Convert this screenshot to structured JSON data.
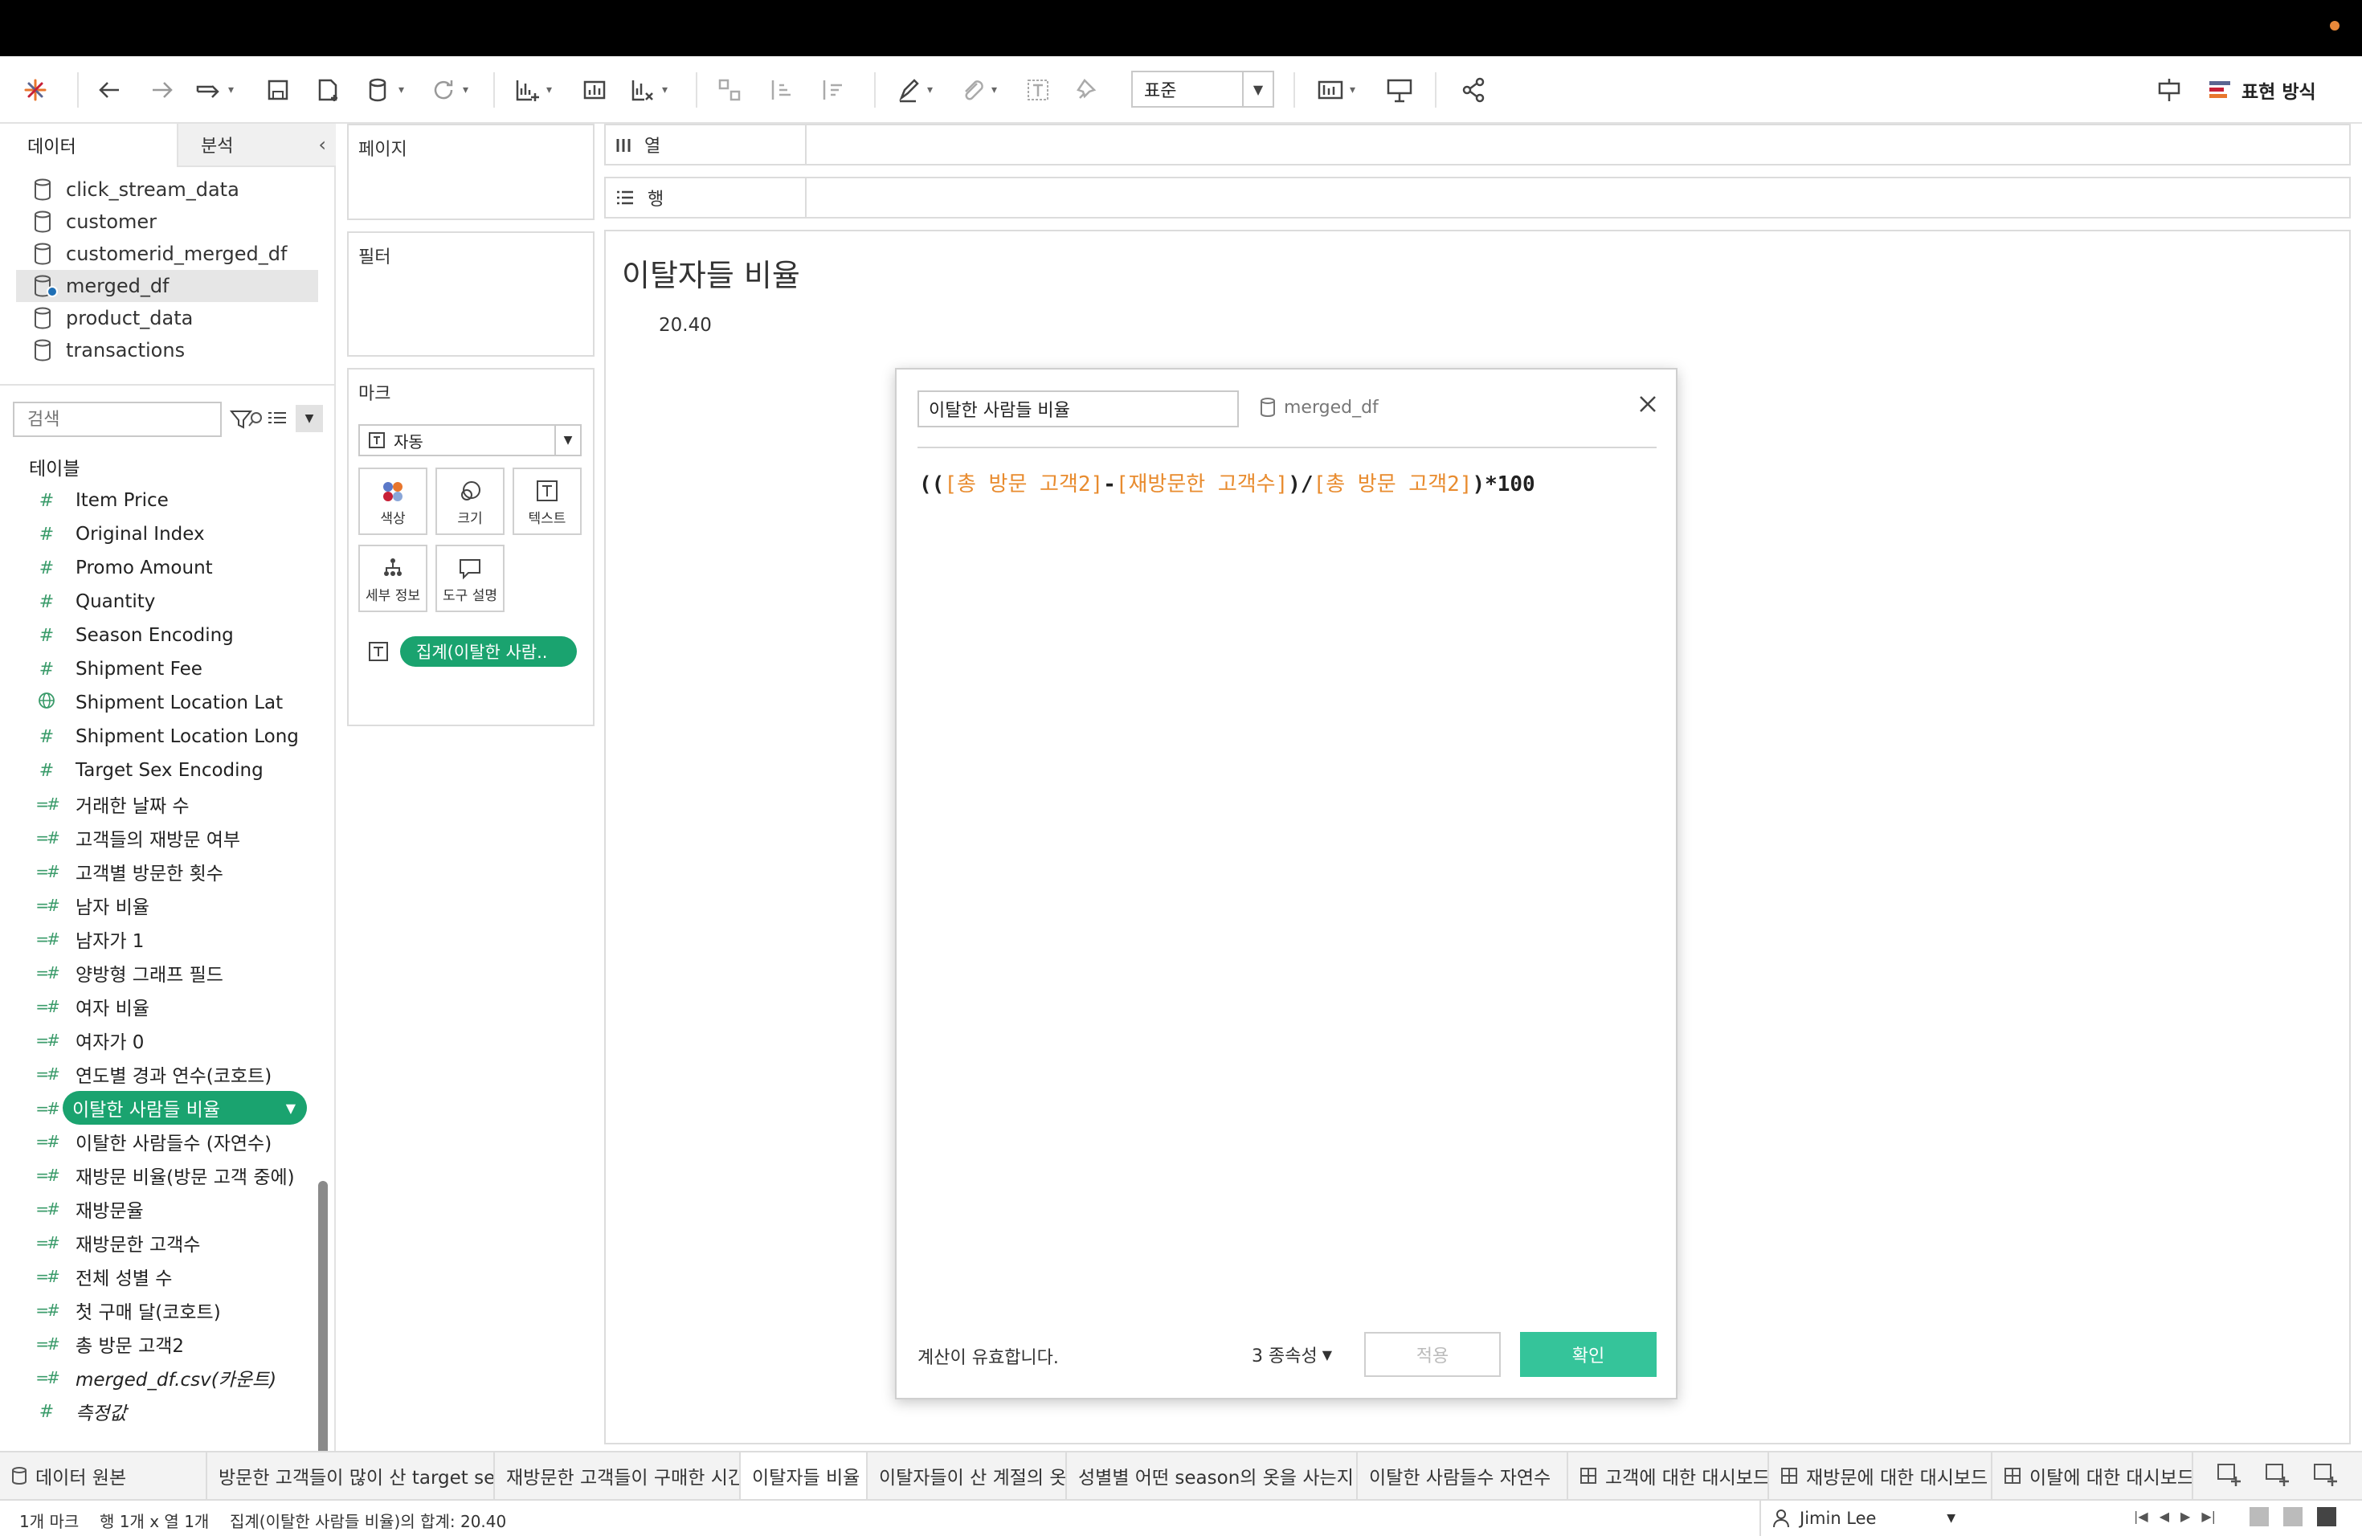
{
  "toolbar": {
    "format_select": "표준",
    "show_me_label": "표현 방식"
  },
  "datapane": {
    "tab_data": "데이터",
    "tab_analysis": "분석",
    "datasources": [
      {
        "name": "click_stream_data",
        "selected": false
      },
      {
        "name": "customer",
        "selected": false
      },
      {
        "name": "customerid_merged_df",
        "selected": false
      },
      {
        "name": "merged_df",
        "selected": true
      },
      {
        "name": "product_data",
        "selected": false
      },
      {
        "name": "transactions",
        "selected": false
      }
    ],
    "search_placeholder": "검색",
    "tables_label": "테이블",
    "fields": [
      {
        "label": "Item Price",
        "icon": "#"
      },
      {
        "label": "Original Index",
        "icon": "#"
      },
      {
        "label": "Promo Amount",
        "icon": "#"
      },
      {
        "label": "Quantity",
        "icon": "#"
      },
      {
        "label": "Season Encoding",
        "icon": "#"
      },
      {
        "label": "Shipment Fee",
        "icon": "#"
      },
      {
        "label": "Shipment Location Lat",
        "icon": "globe"
      },
      {
        "label": "Shipment Location Long",
        "icon": "#"
      },
      {
        "label": "Target Sex Encoding",
        "icon": "#"
      },
      {
        "label": "거래한 날짜 수",
        "icon": "=#"
      },
      {
        "label": "고객들의 재방문 여부",
        "icon": "=#"
      },
      {
        "label": "고객별 방문한 횟수",
        "icon": "=#"
      },
      {
        "label": "남자 비율",
        "icon": "=#"
      },
      {
        "label": "남자가 1",
        "icon": "=#"
      },
      {
        "label": "양방형 그래프 필드",
        "icon": "=#"
      },
      {
        "label": "여자 비율",
        "icon": "=#"
      },
      {
        "label": "여자가 0",
        "icon": "=#"
      },
      {
        "label": "연도별 경과 연수(코호트)",
        "icon": "=#"
      },
      {
        "label": "이탈한 사람들 비율",
        "icon": "=#",
        "selected": true
      },
      {
        "label": "이탈한 사람들수 (자연수)",
        "icon": "=#"
      },
      {
        "label": "재방문 비율(방문 고객 중에)",
        "icon": "=#"
      },
      {
        "label": "재방문율",
        "icon": "=#"
      },
      {
        "label": "재방문한 고객수",
        "icon": "=#"
      },
      {
        "label": "전체 성별 수",
        "icon": "=#"
      },
      {
        "label": "첫 구매 달(코호트)",
        "icon": "=#"
      },
      {
        "label": "총 방문 고객2",
        "icon": "=#"
      },
      {
        "label": "merged_df.csv(카운트)",
        "icon": "=#",
        "italic": true
      },
      {
        "label": "측정값",
        "icon": "#",
        "italic": true
      }
    ]
  },
  "shelves": {
    "pages": "페이지",
    "filters": "필터",
    "marks": "마크",
    "mark_type": "자동",
    "color": "색상",
    "size": "크기",
    "text": "텍스트",
    "detail": "세부 정보",
    "tooltip": "도구 설명",
    "agg_pill": "집계(이탈한 사람..",
    "columns": "열",
    "rows": "행"
  },
  "view": {
    "title": "이탈자들 비율",
    "value": "20.40"
  },
  "calc_dialog": {
    "name": "이탈한 사람들 비율",
    "source": "merged_df",
    "formula": {
      "p1": "((",
      "f1": "[총 방문 고객2]",
      "p2": "-",
      "f2": "[재방문한 고객수]",
      "p3": ")/",
      "f3": "[총 방문 고객2]",
      "p4": ")*100"
    },
    "status": "계산이 유효합니다.",
    "dependencies": "3 종속성",
    "apply": "적용",
    "ok": "확인"
  },
  "sheet_tabs": {
    "data_source": "데이터 원본",
    "tabs": [
      {
        "label": "방문한 고객들이 많이 산 target se...",
        "type": "sheet"
      },
      {
        "label": "재방문한 고객들이 구매한 시간",
        "type": "sheet"
      },
      {
        "label": "이탈자들 비율",
        "type": "sheet",
        "active": true
      },
      {
        "label": "이탈자들이 산 계절의 옷",
        "type": "sheet"
      },
      {
        "label": "성별별 어떤 season의 옷을 사는지",
        "type": "sheet"
      },
      {
        "label": "이탈한 사람들수 자연수",
        "type": "sheet"
      },
      {
        "label": "고객에 대한 대시보드",
        "type": "dashboard"
      },
      {
        "label": "재방문에 대한 대시보드",
        "type": "dashboard"
      },
      {
        "label": "이탈에 대한 대시보드",
        "type": "dashboard"
      }
    ]
  },
  "statusbar": {
    "marks": "1개 마크",
    "rows_cols": "행 1개 x 열 1개",
    "sum": "집계(이탈한 사람들 비율)의 합계: 20.40",
    "user": "Jimin Lee"
  },
  "colors": {
    "accent_green": "#1aa36f",
    "ok_button": "#35c49a",
    "formula_field": "#e88b2e",
    "measure_icon": "#3a9b6a"
  }
}
